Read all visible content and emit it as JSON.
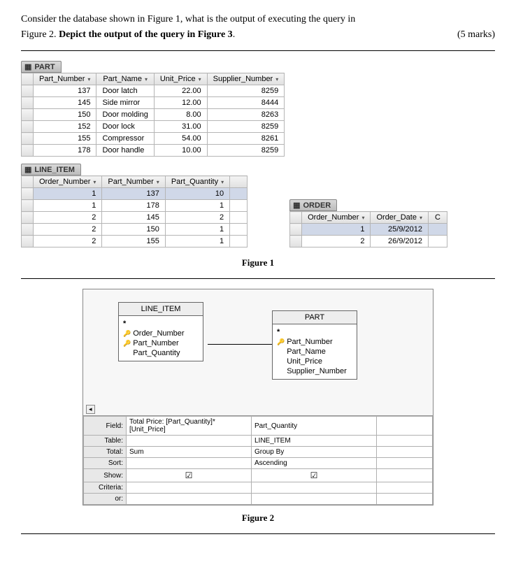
{
  "question": {
    "line1": "Consider the database shown in Figure 1, what is the output of executing the query in",
    "line2_prefix": "Figure 2. ",
    "line2_bold": "Depict the output of the query in Figure 3",
    "line2_suffix": ".",
    "marks": "(5 marks)"
  },
  "part_table": {
    "title": "PART",
    "columns": [
      "Part_Number",
      "Part_Name",
      "Unit_Price",
      "Supplier_Number"
    ],
    "rows": [
      {
        "pn": "137",
        "name": "Door latch",
        "price": "22.00",
        "sup": "8259"
      },
      {
        "pn": "145",
        "name": "Side mirror",
        "price": "12.00",
        "sup": "8444"
      },
      {
        "pn": "150",
        "name": "Door molding",
        "price": "8.00",
        "sup": "8263"
      },
      {
        "pn": "152",
        "name": "Door lock",
        "price": "31.00",
        "sup": "8259"
      },
      {
        "pn": "155",
        "name": "Compressor",
        "price": "54.00",
        "sup": "8261"
      },
      {
        "pn": "178",
        "name": "Door handle",
        "price": "10.00",
        "sup": "8259"
      }
    ]
  },
  "line_item_table": {
    "title": "LINE_ITEM",
    "columns": [
      "Order_Number",
      "Part_Number",
      "Part_Quantity"
    ],
    "rows": [
      {
        "on": "1",
        "pn": "137",
        "qty": "10",
        "sel": true
      },
      {
        "on": "1",
        "pn": "178",
        "qty": "1"
      },
      {
        "on": "2",
        "pn": "145",
        "qty": "2"
      },
      {
        "on": "2",
        "pn": "150",
        "qty": "1"
      },
      {
        "on": "2",
        "pn": "155",
        "qty": "1"
      }
    ]
  },
  "order_table": {
    "title": "ORDER",
    "columns": [
      "Order_Number",
      "Order_Date"
    ],
    "extra_col_hint": "C",
    "rows": [
      {
        "on": "1",
        "dt": "25/9/2012",
        "sel": true
      },
      {
        "on": "2",
        "dt": "26/9/2012"
      }
    ]
  },
  "fig1_caption": "Figure 1",
  "fig2_caption": "Figure 2",
  "design": {
    "tables": {
      "line_item": {
        "title": "LINE_ITEM",
        "star": "*",
        "fields": [
          {
            "name": "Order_Number",
            "key": true
          },
          {
            "name": "Part_Number",
            "key": true
          },
          {
            "name": "Part_Quantity",
            "key": false
          }
        ]
      },
      "part": {
        "title": "PART",
        "star": "*",
        "fields": [
          {
            "name": "Part_Number",
            "key": true
          },
          {
            "name": "Part_Name",
            "key": false
          },
          {
            "name": "Unit_Price",
            "key": false
          },
          {
            "name": "Supplier_Number",
            "key": false
          }
        ]
      }
    },
    "qbe": {
      "row_labels": [
        "Field:",
        "Table:",
        "Total:",
        "Sort:",
        "Show:",
        "Criteria:",
        "or:"
      ],
      "col1": {
        "field": "Total Price: [Part_Quantity]*[Unit_Price]",
        "table": "",
        "total": "Sum",
        "sort": "",
        "show": "☑",
        "criteria": "",
        "or": ""
      },
      "col2": {
        "field": "Part_Quantity",
        "table": "LINE_ITEM",
        "total": "Group By",
        "sort": "Ascending",
        "show": "☑",
        "criteria": "",
        "or": ""
      }
    }
  },
  "icons": {
    "datasheet": "▦",
    "arrow": "▾",
    "key": "🔑",
    "left": "◂"
  }
}
